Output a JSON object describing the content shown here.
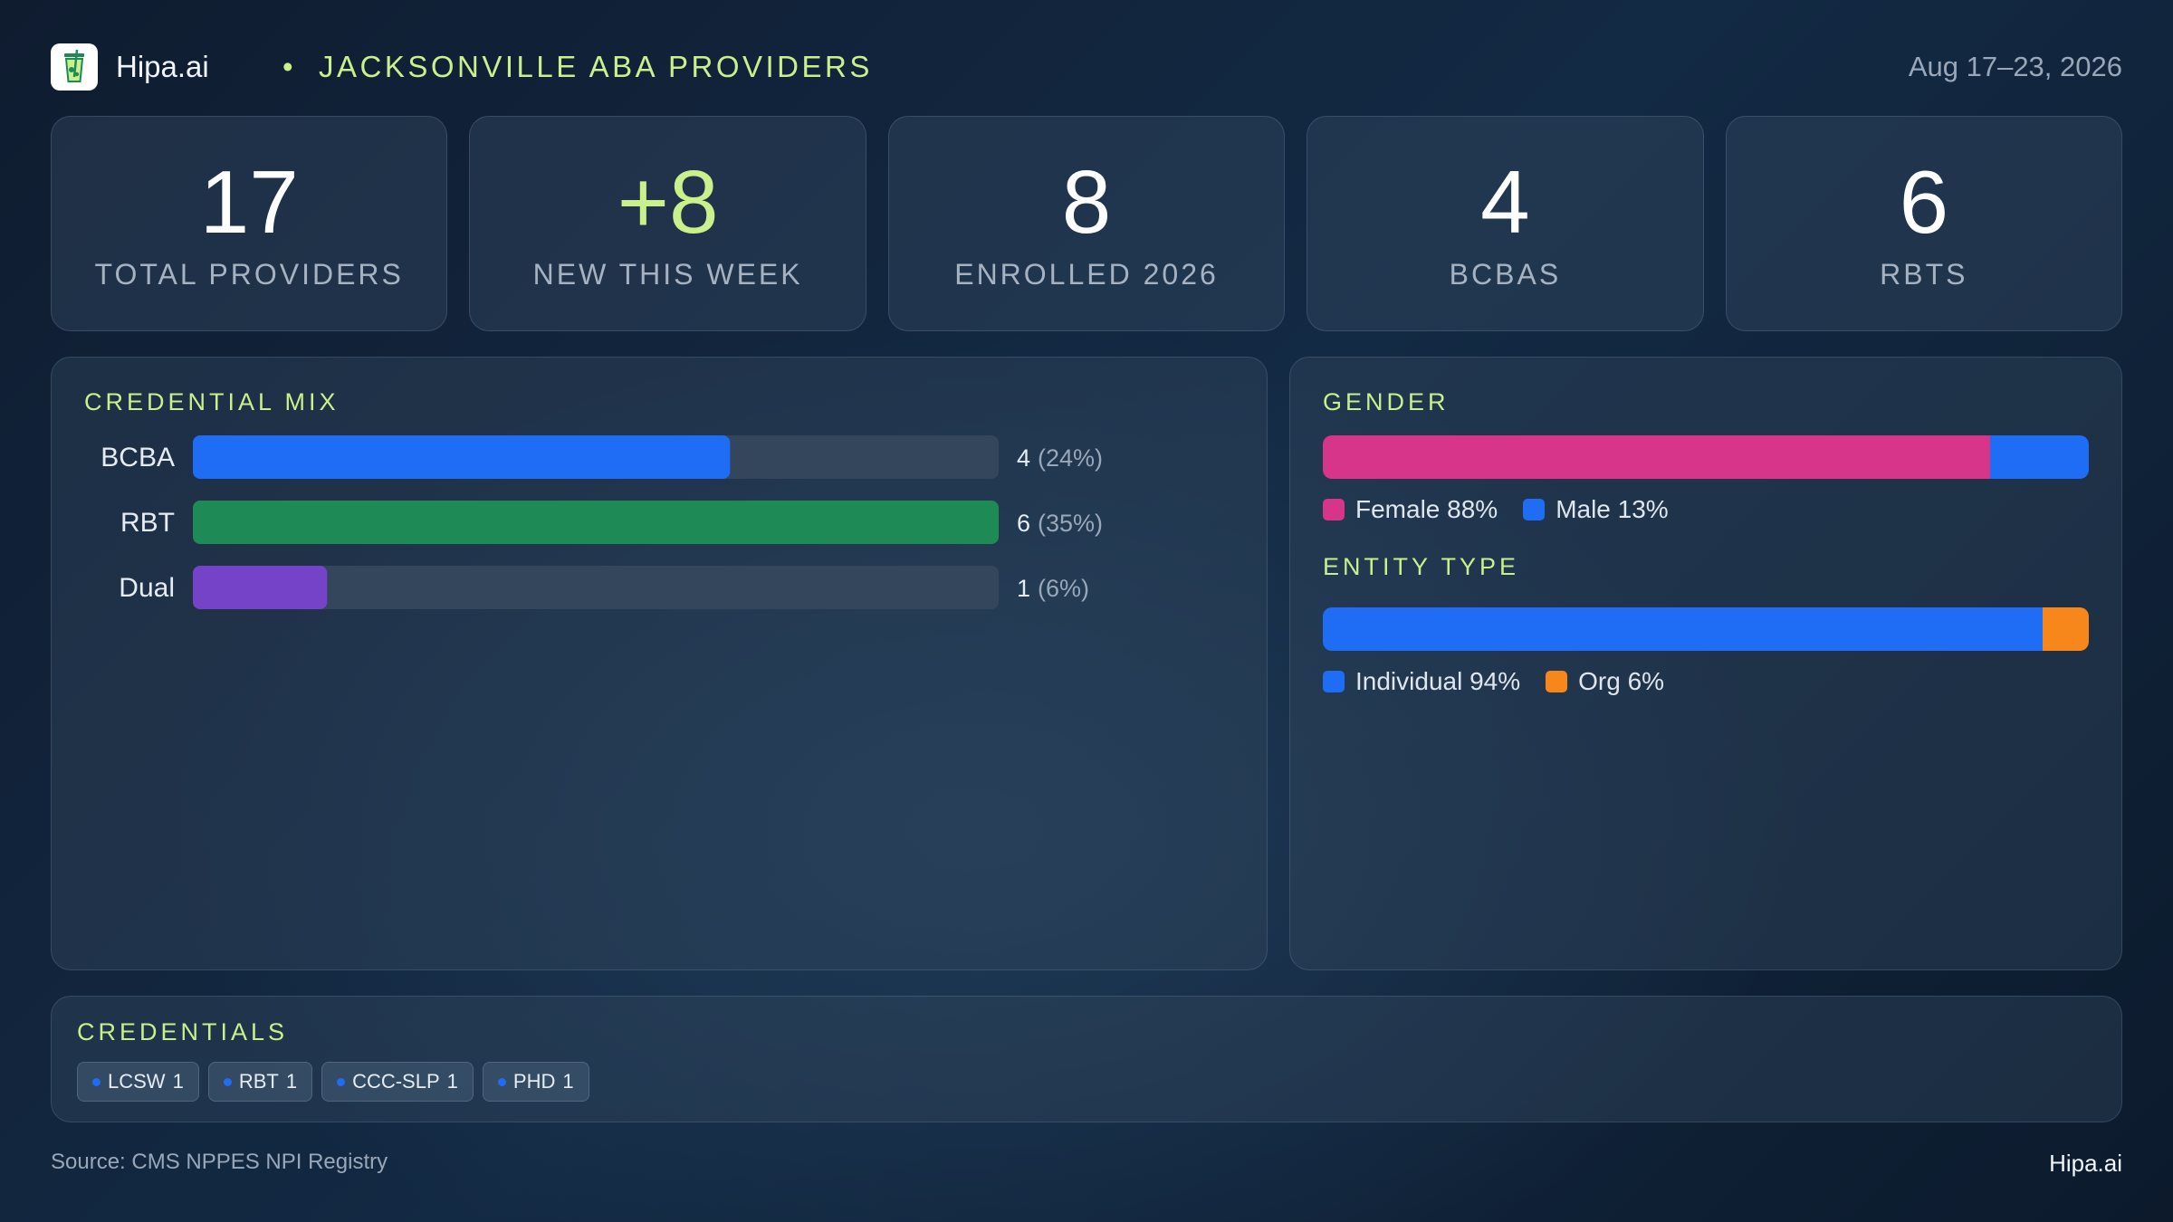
{
  "header": {
    "brand": "Hipa.ai",
    "separator": "•",
    "title": "JACKSONVILLE ABA PROVIDERS",
    "date_range": "Aug 17–23, 2026",
    "logo_icon": "drink-cup-icon"
  },
  "kpis": [
    {
      "value": "17",
      "label": "TOTAL PROVIDERS"
    },
    {
      "value": "+8",
      "label": "NEW THIS WEEK"
    },
    {
      "value": "8",
      "label": "ENROLLED 2026"
    },
    {
      "value": "4",
      "label": "BCBAS"
    },
    {
      "value": "6",
      "label": "RBTS"
    }
  ],
  "credential_mix": {
    "title": "CREDENTIAL MIX"
  },
  "gender": {
    "title": "GENDER"
  },
  "entity_type": {
    "title": "ENTITY TYPE"
  },
  "credentials": {
    "title": "CREDENTIALS",
    "chips": [
      {
        "name": "LCSW",
        "count": "1"
      },
      {
        "name": "RBT",
        "count": "1"
      },
      {
        "name": "CCC-SLP",
        "count": "1"
      },
      {
        "name": "PHD",
        "count": "1"
      }
    ]
  },
  "footer": {
    "source": "Source: CMS NPPES NPI Registry",
    "brand": "Hipa.ai"
  },
  "colors": {
    "accent": "#c8f08c",
    "blue": "#1f6cf5",
    "green": "#1e8a55",
    "purple": "#7443c8",
    "pink": "#d7358a",
    "orange": "#f7861b",
    "track": "#33465c"
  },
  "chart_data": [
    {
      "type": "bar",
      "title": "CREDENTIAL MIX",
      "orientation": "horizontal",
      "categories": [
        "BCBA",
        "RBT",
        "Dual"
      ],
      "values": [
        4,
        6,
        1
      ],
      "value_labels": [
        "4",
        "6",
        "1"
      ],
      "percent_labels": [
        "(24%)",
        "(35%)",
        "(6%)"
      ],
      "colors": [
        "#1f6cf5",
        "#1e8a55",
        "#7443c8"
      ],
      "xlim": [
        0,
        6
      ]
    },
    {
      "type": "bar",
      "title": "GENDER",
      "stacked": true,
      "series": [
        {
          "name": "Female",
          "value": 88,
          "label": "Female 88%",
          "color": "#d7358a"
        },
        {
          "name": "Male",
          "value": 13,
          "label": "Male 13%",
          "color": "#1f6cf5"
        }
      ]
    },
    {
      "type": "bar",
      "title": "ENTITY TYPE",
      "stacked": true,
      "series": [
        {
          "name": "Individual",
          "value": 94,
          "label": "Individual 94%",
          "color": "#1f6cf5"
        },
        {
          "name": "Org",
          "value": 6,
          "label": "Org 6%",
          "color": "#f7861b"
        }
      ]
    }
  ]
}
